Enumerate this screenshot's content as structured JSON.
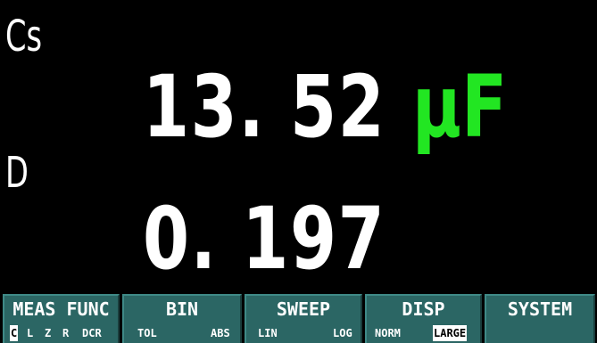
{
  "display": {
    "primary_param": "Cs",
    "primary_value": "13. 52",
    "primary_unit": "μF",
    "secondary_param": "D",
    "secondary_value": "0. 197",
    "unit_color": "#22e622"
  },
  "softkeys": [
    {
      "title": "MEAS FUNC",
      "options": [
        "C",
        "L",
        "Z",
        "R",
        "DCR"
      ],
      "selected": "C"
    },
    {
      "title": "BIN",
      "options": [
        "TOL",
        "ABS"
      ],
      "selected": ""
    },
    {
      "title": "SWEEP",
      "options": [
        "LIN",
        "LOG"
      ],
      "selected": ""
    },
    {
      "title": "DISP",
      "options": [
        "NORM",
        "LARGE"
      ],
      "selected": "LARGE"
    },
    {
      "title": "SYSTEM",
      "options": [],
      "selected": ""
    }
  ],
  "colors": {
    "background": "#000000",
    "softkey_bg": "#2b6664",
    "text": "#ffffff"
  }
}
